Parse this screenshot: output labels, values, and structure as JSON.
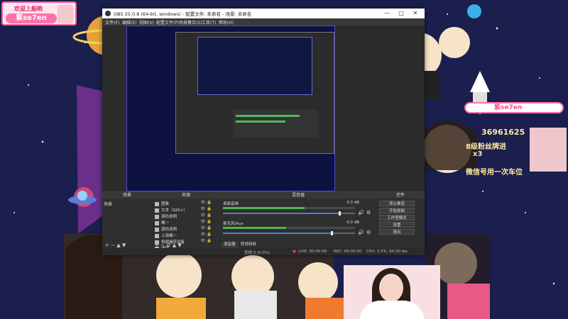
{
  "colors": {
    "accent_pink": "#ff5c9b",
    "obs_bg": "#2b2b2b",
    "meter_green": "#4fb54f",
    "meter_blue": "#4d7fd2",
    "space_bg": "#1a1f4e"
  },
  "overlay": {
    "top_badge": {
      "line1": "欢迎上船哟",
      "line2": "紫se7en"
    },
    "right_panel": {
      "handle": "紫se7en",
      "fan_id": "36961625",
      "group_text": "8级粉丝牌进",
      "gift_line": "x3",
      "bottom_text": "微信号用一次车位"
    }
  },
  "obs": {
    "title": "OBS 25.0.8 (64-bit, windows) - 配置文件: 未命名 - 场景: 未命名",
    "window_controls": {
      "minimize": "—",
      "maximize": "□",
      "close": "✕"
    },
    "menu": [
      "文件(F)",
      "编辑(E)",
      "视图(V)",
      "配置文件(P)",
      "场景集合(S)",
      "工具(T)",
      "帮助(H)"
    ],
    "docks": {
      "scenes": {
        "title": "场景",
        "items": [
          "场景"
        ]
      },
      "sources": {
        "title": "来源",
        "items": [
          "图像",
          "文本（GDI+）",
          "源码说明",
          "橘一",
          "源码说明",
          "上海橘一",
          "视频捕获设备",
          "滤镜"
        ]
      },
      "mixer": {
        "title": "混音器",
        "tracks": [
          {
            "name": "桌面音频",
            "db": "0.0 dB",
            "level": 0.62,
            "volume": 0.88
          },
          {
            "name": "麦克风/Aux",
            "db": "0.0 dB",
            "level": 0.48,
            "volume": 0.82
          }
        ],
        "tabs": [
          "混音器",
          "转场特效"
        ]
      },
      "controls": {
        "title": "控件",
        "buttons": [
          "停止推流",
          "开始录制",
          "工作室模式",
          "设置",
          "退出"
        ]
      }
    },
    "status": {
      "drop": "丢帧 0 (0.0%)",
      "live": "LIVE: 00:00:00",
      "rec": "REC: 00:00:00",
      "cpu": "CPU: 3.5%, 60.00 fps"
    }
  }
}
